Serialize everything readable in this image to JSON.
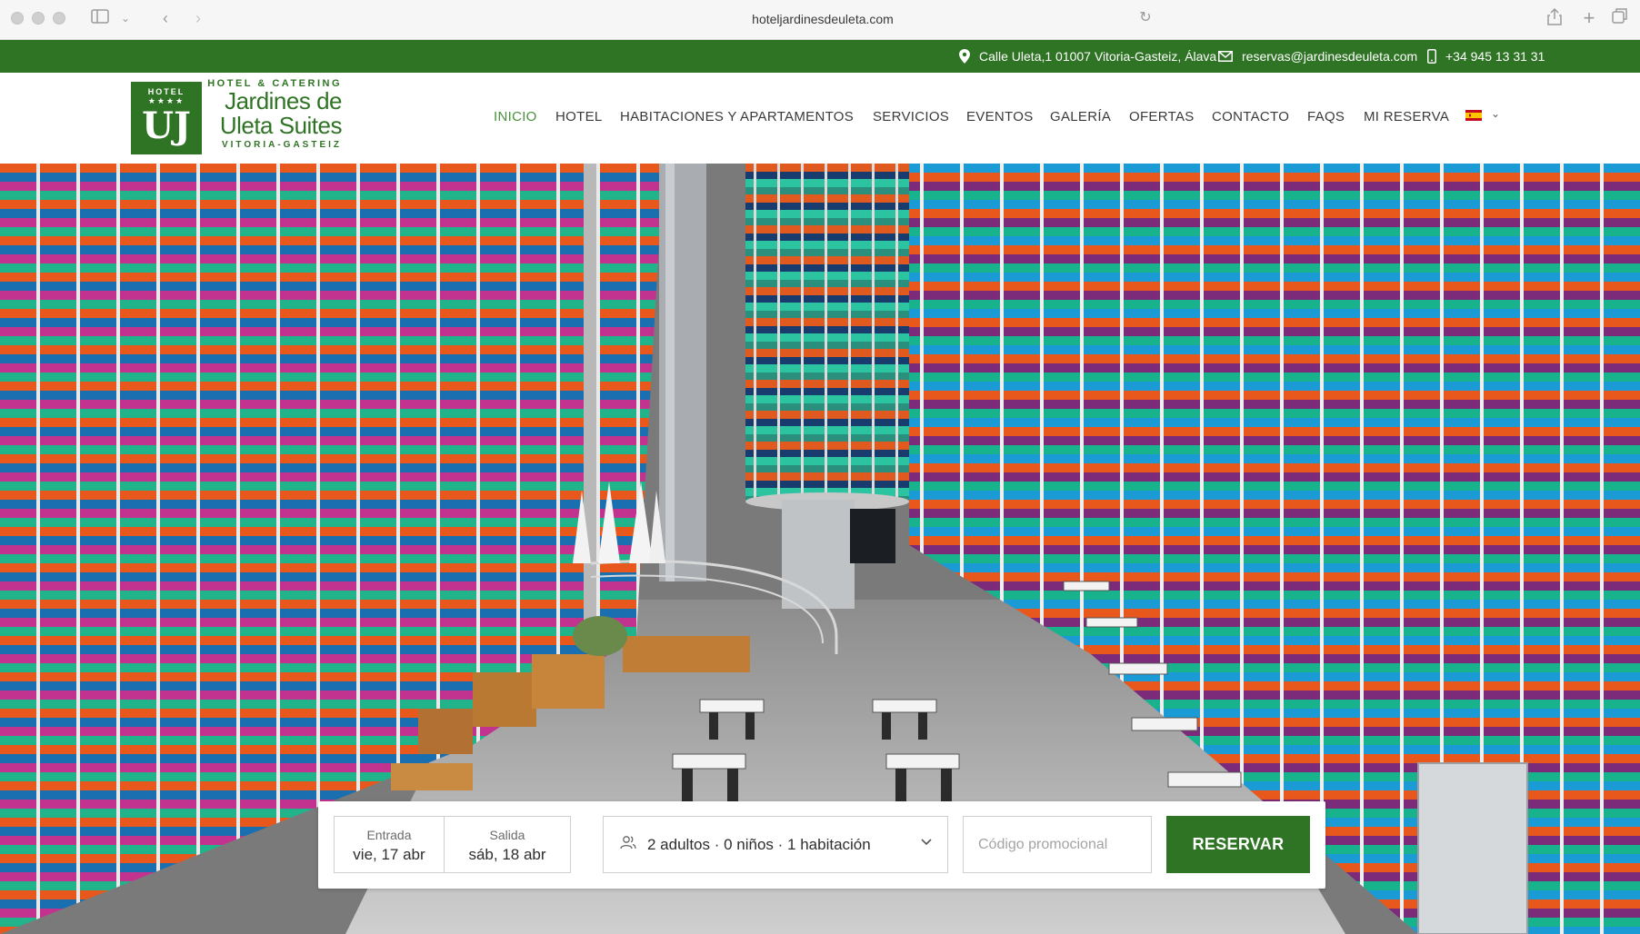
{
  "browser": {
    "url": "hoteljardinesdeuleta.com"
  },
  "topbar": {
    "address": "Calle Uleta,1 01007 Vitoria-Gasteiz, Álava",
    "email": "reservas@jardinesdeuleta.com",
    "phone": "+34 945 13 31 31",
    "background": "#2f7424"
  },
  "logo": {
    "hotel": "HOTEL",
    "stars": "★★★★",
    "monogram": "UJ",
    "tagline": "HOTEL & CATERING",
    "name_line1": "Jardines de",
    "name_line2": "Uleta Suites",
    "city": "VITORIA-GASTEIZ"
  },
  "nav": {
    "items": [
      {
        "label": "INICIO",
        "active": true
      },
      {
        "label": "HOTEL"
      },
      {
        "label": "HABITACIONES Y APARTAMENTOS"
      },
      {
        "label": "SERVICIOS"
      },
      {
        "label": "EVENTOS"
      },
      {
        "label": "GALERÍA"
      },
      {
        "label": "OFERTAS"
      },
      {
        "label": "CONTACTO"
      },
      {
        "label": "FAQS"
      },
      {
        "label": "MI RESERVA"
      }
    ],
    "language_flag": "spain-flag-icon",
    "active_color": "#4a8f3b"
  },
  "booking": {
    "checkin_label": "Entrada",
    "checkin_value": "vie, 17 abr",
    "checkout_label": "Salida",
    "checkout_value": "sáb, 18 abr",
    "guests_value": "2 adultos · 0 niños · 1 habitación",
    "promo_placeholder": "Código promocional",
    "reserve_label": "RESERVAR",
    "button_color": "#2f7424"
  }
}
